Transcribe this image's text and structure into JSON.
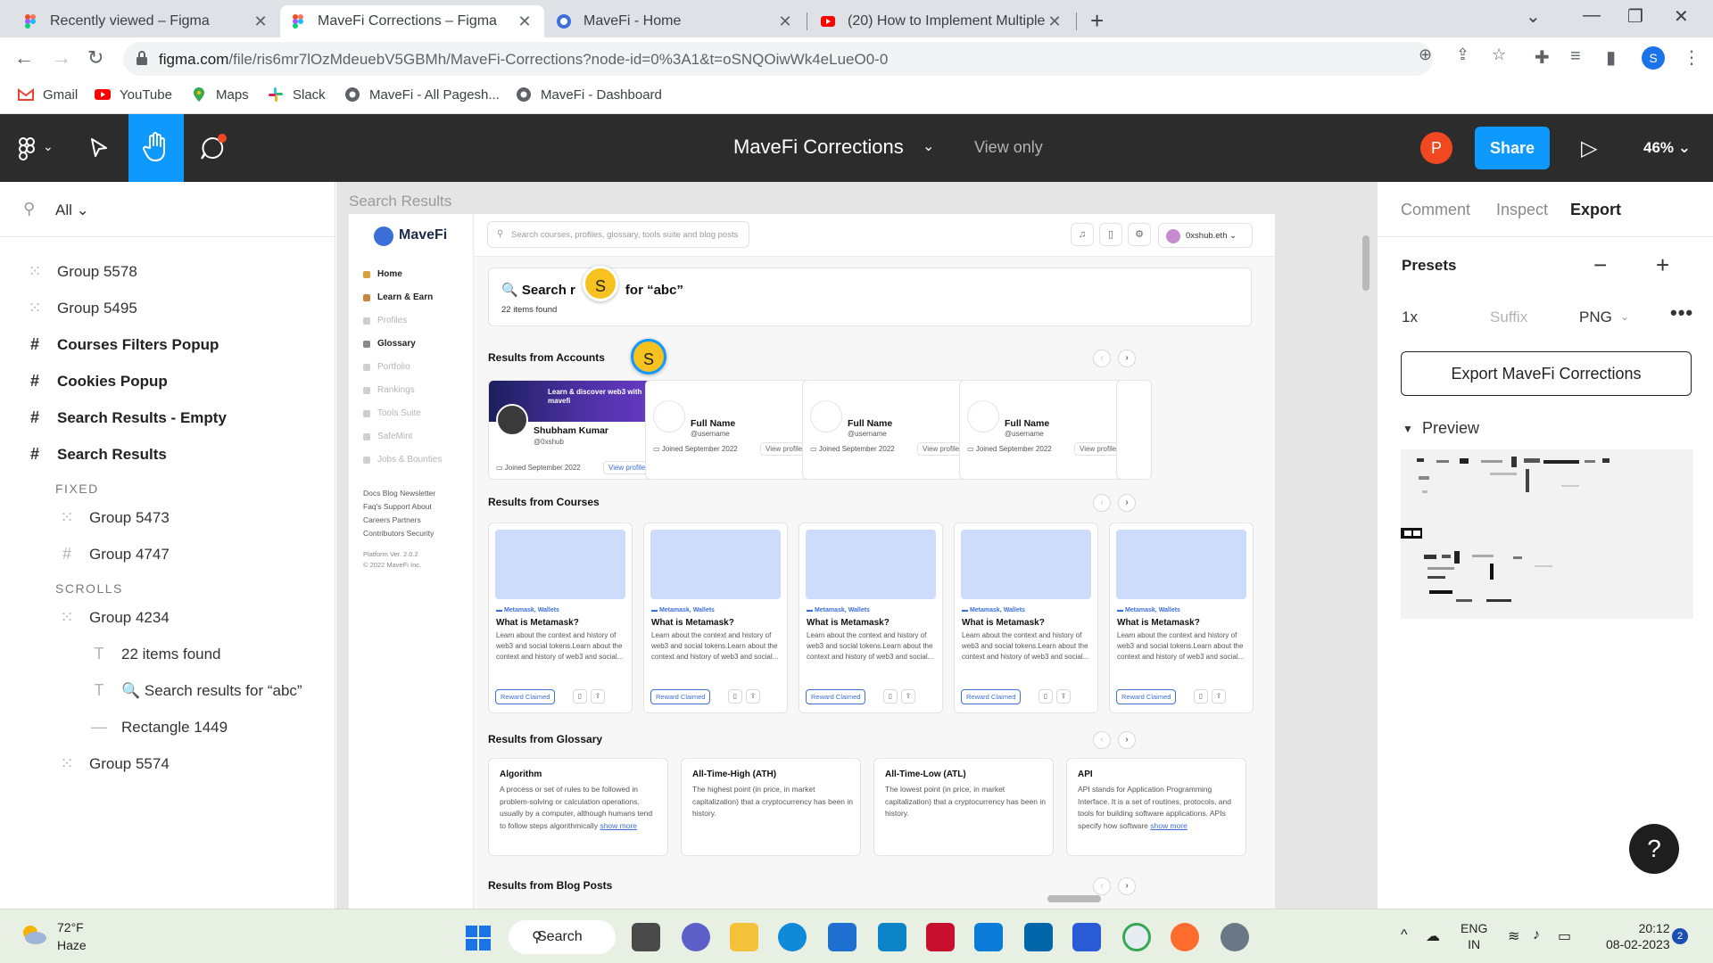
{
  "browser": {
    "tabs": [
      {
        "title": "Recently viewed – Figma",
        "icon": "figma-icon",
        "active": false
      },
      {
        "title": "MaveFi Corrections – Figma",
        "icon": "figma-icon",
        "active": true
      },
      {
        "title": "MaveFi - Home",
        "icon": "mavefi-icon",
        "active": false
      },
      {
        "title": "(20) How to Implement Multiple",
        "icon": "youtube-icon",
        "active": false
      }
    ],
    "url_main": "figma.com",
    "url_rest": "/file/ris6mr7lOzMdeuebV5GBMh/MaveFi-Corrections?node-id=0%3A1&t=oSNQOiwWk4eLueO0-0",
    "profile_initial": "S",
    "bookmarks": [
      "Gmail",
      "YouTube",
      "Maps",
      "Slack",
      "MaveFi - All Pagesh...",
      "MaveFi - Dashboard"
    ]
  },
  "figma": {
    "file_title": "MaveFi Corrections",
    "view_mode": "View only",
    "avatar_initial": "P",
    "share_label": "Share",
    "zoom": "46%",
    "colors": {
      "accent": "#0d99ff",
      "avatar": "#f24822",
      "topbar": "#2c2c2c"
    }
  },
  "layers": {
    "filter_label": "All",
    "items": [
      {
        "name": "Group 5578",
        "kind": "group"
      },
      {
        "name": "Group 5495",
        "kind": "group"
      },
      {
        "name": "Courses Filters Popup",
        "kind": "frame"
      },
      {
        "name": "Cookies Popup",
        "kind": "frame"
      },
      {
        "name": "Search Results - Empty",
        "kind": "frame"
      },
      {
        "name": "Search Results",
        "kind": "frame"
      }
    ],
    "section_fixed": "FIXED",
    "fixed_items": [
      {
        "name": "Group 5473",
        "kind": "group"
      },
      {
        "name": "Group 4747",
        "kind": "frame"
      }
    ],
    "section_scrolls": "SCROLLS",
    "scroll_items": [
      {
        "name": "Group 4234",
        "kind": "group"
      },
      {
        "name": "22 items found",
        "kind": "text"
      },
      {
        "name": "🔍 Search results for “abc”",
        "kind": "text"
      },
      {
        "name": "Rectangle 1449",
        "kind": "rect"
      },
      {
        "name": "Group 5574",
        "kind": "group"
      }
    ]
  },
  "canvas": {
    "frame_label": "Search Results",
    "design": {
      "brand": "MaveFi",
      "nav": [
        {
          "label": "Home",
          "state": "active"
        },
        {
          "label": "Learn & Earn",
          "state": "active"
        },
        {
          "label": "Profiles",
          "state": "disabled"
        },
        {
          "label": "Glossary",
          "state": "active"
        },
        {
          "label": "Portfolio",
          "state": "disabled"
        },
        {
          "label": "Rankings",
          "state": "disabled"
        },
        {
          "label": "Tools Suite",
          "state": "disabled"
        },
        {
          "label": "SafeMint",
          "state": "disabled"
        },
        {
          "label": "Jobs & Bounties",
          "state": "disabled"
        }
      ],
      "footer_links": [
        "Docs  Blog  Newsletter",
        "Faq's  Support  About",
        "Careers  Partners",
        "Contributors  Security"
      ],
      "version": "Platform Ver. 2.0.2",
      "copyright": "© 2022 MaveFi Inc.",
      "search_placeholder": "Search courses, profiles, glossary, tools suite and blog posts",
      "username": "0xshub.eth",
      "search_heading_a": "Search r",
      "search_heading_b": "for “abc”",
      "items_found": "22 items found",
      "sections": {
        "accounts": "Results from Accounts",
        "courses": "Results from Courses",
        "glossary": "Results from Glossary",
        "blog": "Results from Blog Posts"
      },
      "accounts": [
        {
          "name": "Shubham Kumar",
          "user": "@0xshub",
          "joined": "Joined September 2022",
          "view": "View profile →",
          "banner": "Learn & discover web3 with mavefi"
        },
        {
          "name": "Full Name",
          "user": "@username",
          "joined": "Joined September 2022",
          "view": "View profile →"
        },
        {
          "name": "Full Name",
          "user": "@username",
          "joined": "Joined September 2022",
          "view": "View profile →"
        },
        {
          "name": "Full Name",
          "user": "@username",
          "joined": "Joined September 2022",
          "view": "View profile →"
        }
      ],
      "courses": [
        {
          "tag": "Metamask, Wallets",
          "title": "What is Metamask?",
          "desc": "Learn about the context and history of web3 and social tokens.Learn about the context and history of web3 and social...",
          "reward": "Reward Claimed"
        },
        {
          "tag": "Metamask, Wallets",
          "title": "What is Metamask?",
          "desc": "Learn about the context and history of web3 and social tokens.Learn about the context and history of web3 and social...",
          "reward": "Reward Claimed"
        },
        {
          "tag": "Metamask, Wallets",
          "title": "What is Metamask?",
          "desc": "Learn about the context and history of web3 and social tokens.Learn about the context and history of web3 and social...",
          "reward": "Reward Claimed"
        },
        {
          "tag": "Metamask, Wallets",
          "title": "What is Metamask?",
          "desc": "Learn about the context and history of web3 and social tokens.Learn about the context and history of web3 and social...",
          "reward": "Reward Claimed"
        },
        {
          "tag": "Metamask, Wallets",
          "title": "What is Metamask?",
          "desc": "Learn about the context and history of web3 and social tokens.Learn about the context and history of web3 and social...",
          "reward": "Reward Claimed"
        }
      ],
      "glossary": [
        {
          "title": "Algorithm",
          "desc": "A process or set of rules to be followed in problem-solving or calculation operations, usually by a computer, although humans tend to follow steps algorithmically",
          "more": "show more"
        },
        {
          "title": "All-Time-High (ATH)",
          "desc": "The highest point (in price, in market capitalization) that a cryptocurrency has been in history.",
          "more": ""
        },
        {
          "title": "All-Time-Low (ATL)",
          "desc": "The lowest point (in price, in market capitalization) that a cryptocurrency has been in history.",
          "more": ""
        },
        {
          "title": "API",
          "desc": "API stands for Application Programming Interface. It is a set of routines, protocols, and tools for building software applications. APIs specify how software",
          "more": "show more"
        }
      ],
      "cursor_initial": "S"
    }
  },
  "right_panel": {
    "tabs": [
      "Comment",
      "Inspect",
      "Export"
    ],
    "active_tab": "Export",
    "presets_label": "Presets",
    "scale": "1x",
    "suffix_placeholder": "Suffix",
    "format": "PNG",
    "export_button": "Export MaveFi Corrections",
    "preview_label": "Preview",
    "help": "?"
  },
  "taskbar": {
    "temperature": "72°F",
    "condition": "Haze",
    "search_label": "Search",
    "lang_1": "ENG",
    "lang_2": "IN",
    "time": "20:12",
    "date": "08-02-2023",
    "notifications": "2"
  }
}
